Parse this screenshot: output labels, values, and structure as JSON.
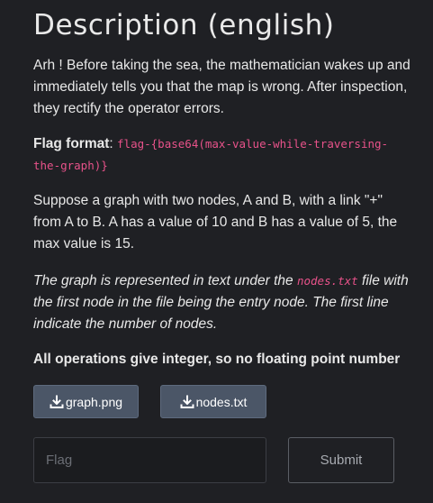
{
  "title": "Description (english)",
  "intro": "Arh ! Before taking the sea, the mathematician wakes up and immediately tells you that the map is wrong. After inspection, they rectify the operator errors.",
  "flag_format": {
    "label": "Flag format",
    "sep": ": ",
    "code": "flag-{base64(max-value-while-traversing-the-graph)}"
  },
  "example": "Suppose a graph with two nodes, A and B, with a link \"+\" from A to B. A has a value of 10 and B has a value of 5, the max value is 15.",
  "note": {
    "before": "The graph is represented in text under the ",
    "file": "nodes.txt",
    "after": " file with the first node in the file being the entry node. The first line indicate the number of nodes."
  },
  "integer_note": "All operations give integer, so no floating point number",
  "downloads": [
    {
      "label": "graph.png",
      "icon": "download-icon"
    },
    {
      "label": "nodes.txt",
      "icon": "download-icon"
    }
  ],
  "flag_input": {
    "placeholder": "Flag",
    "value": ""
  },
  "submit_label": "Submit",
  "colors": {
    "background": "#1f2024",
    "code": "#e8528a",
    "download_button": "#4b5667"
  }
}
